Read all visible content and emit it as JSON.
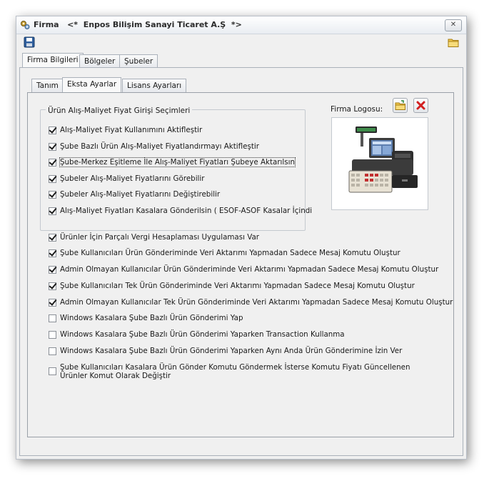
{
  "window": {
    "title": "Firma   <*  Enpos Bilişim Sanayi Ticaret A.Ş  *>",
    "close_label": "✕"
  },
  "main_tabs": [
    {
      "label": "Firma Bilgileri",
      "active": true
    },
    {
      "label": "Bölgeler",
      "active": false
    },
    {
      "label": "Şubeler",
      "active": false
    }
  ],
  "sub_tabs": [
    {
      "label": "Tanım",
      "active": false
    },
    {
      "label": "Eksta Ayarlar",
      "active": true
    },
    {
      "label": "Lisans Ayarları",
      "active": false
    }
  ],
  "group": {
    "title": "Ürün Alış-Maliyet Fiyat Girişi Seçimleri",
    "options": [
      {
        "label": "Alış-Maliyet Fiyat Kullanımını Aktifleştir",
        "checked": true
      },
      {
        "label": "Şube Bazlı Ürün Alış-Maliyet Fiyatlandırmayı Aktifleştir",
        "checked": true
      },
      {
        "label": "Şube-Merkez Eşitleme İle Alış-Maliyet Fiyatları Şubeye Aktarılsın",
        "checked": true
      },
      {
        "label": "Şubeler Alış-Maliyet Fiyatlarını Görebilir",
        "checked": true
      },
      {
        "label": "Şubeler Alış-Maliyet Fiyatlarını Değiştirebilir",
        "checked": true
      },
      {
        "label": "Alış-Maliyet Fiyatları Kasalara Gönderilsin ( ESOF-ASOF Kasalar İçindi",
        "checked": true
      }
    ]
  },
  "logo": {
    "label": "Firma Logosu:"
  },
  "options": [
    {
      "label": "Ürünler İçin Parçalı Vergi Hesaplaması Uygulaması Var",
      "checked": true
    },
    {
      "label": "Şube Kullanıcıları Ürün Gönderiminde Veri Aktarımı Yapmadan Sadece Mesaj Komutu Oluştur",
      "checked": true
    },
    {
      "label": "Admin Olmayan Kullanıcılar Ürün Gönderiminde Veri Aktarımı Yapmadan Sadece Mesaj Komutu Oluştur",
      "checked": true
    },
    {
      "label": "Şube Kullanıcıları Tek Ürün Gönderiminde Veri Aktarımı Yapmadan Sadece Mesaj Komutu Oluştur",
      "checked": true
    },
    {
      "label": "Admin Olmayan Kullanıcılar Tek Ürün Gönderiminde Veri Aktarımı Yapmadan Sadece Mesaj Komutu Oluştur",
      "checked": true
    },
    {
      "label": "Windows Kasalara Şube Bazlı Ürün Gönderimi Yap",
      "checked": false
    },
    {
      "label": "Windows Kasalara Şube Bazlı Ürün Gönderimi Yaparken Transaction Kullanma",
      "checked": false
    },
    {
      "label": "Windows Kasalara Şube Bazlı Ürün Gönderimi Yaparken Aynı Anda Ürün Gönderimine İzin Ver",
      "checked": false
    },
    {
      "label": "Şube Kullanıcıları Kasalara Ürün Gönder Komutu Göndermek İsterse Komutu Fiyatı Güncellenen Ürünler Komut Olarak Değiştir",
      "checked": false
    }
  ]
}
